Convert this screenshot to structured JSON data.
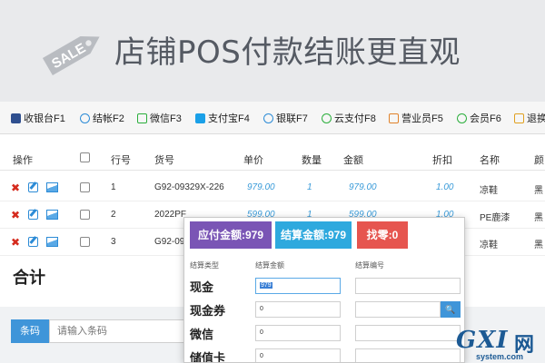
{
  "banner": {
    "sale_text": "SALE",
    "title": "店铺POS付款结账更直观"
  },
  "toolbar": {
    "items": [
      {
        "label": "收银台F1",
        "icon": "cashier-icon",
        "color": "#2f4f8f"
      },
      {
        "label": "结帐F2",
        "icon": "yen-icon",
        "color": "#2c8bd6"
      },
      {
        "label": "微信F3",
        "icon": "wechat-icon",
        "color": "#2aae3b"
      },
      {
        "label": "支付宝F4",
        "icon": "alipay-icon",
        "color": "#1aa0e8"
      },
      {
        "label": "银联F7",
        "icon": "yen-icon",
        "color": "#2c8bd6"
      },
      {
        "label": "云支付F8",
        "icon": "cloud-pay-icon",
        "color": "#2aae3b"
      },
      {
        "label": "营业员F5",
        "icon": "staff-icon",
        "color": "#e0822a"
      },
      {
        "label": "会员F6",
        "icon": "member-icon",
        "color": "#2aae3b"
      },
      {
        "label": "退换",
        "icon": "return-icon",
        "color": "#e0a020"
      }
    ]
  },
  "table": {
    "headers": [
      "操作",
      "",
      "行号",
      "货号",
      "单价",
      "数量",
      "金额",
      "折扣",
      "名称",
      "颜"
    ],
    "rows": [
      {
        "line": "1",
        "sku": "G92-09329X-226",
        "price": "979.00",
        "qty": "1",
        "amount": "979.00",
        "discount": "1.00",
        "name": "凉鞋",
        "color": "黑"
      },
      {
        "line": "2",
        "sku": "2022PF",
        "price": "599.00",
        "qty": "1",
        "amount": "599.00",
        "discount": "1.00",
        "name": "PE鹿漆",
        "color": "黑"
      },
      {
        "line": "3",
        "sku": "G92-09",
        "price": "",
        "qty": "",
        "amount": "",
        "discount": "",
        "name": "凉鞋",
        "color": "黑"
      }
    ]
  },
  "total_label": "合计",
  "barcode": {
    "button_label": "条码",
    "placeholder": "请输入条码"
  },
  "payment": {
    "due": "应付金额:979",
    "settled": "结算金额:979",
    "change": "找零:0",
    "colors": {
      "due": "#7a55b5",
      "settled": "#2ea9de",
      "change": "#e6554f"
    },
    "columns": [
      "结算类型",
      "结算金额",
      "结算编号"
    ],
    "methods": [
      {
        "label": "现金",
        "amount": "979"
      },
      {
        "label": "现金券",
        "amount": "0"
      },
      {
        "label": "微信",
        "amount": "0"
      },
      {
        "label": "储值卡",
        "amount": "0"
      }
    ]
  },
  "watermark": {
    "logo": "GXI",
    "cn": "网",
    "sub": "system.com"
  }
}
